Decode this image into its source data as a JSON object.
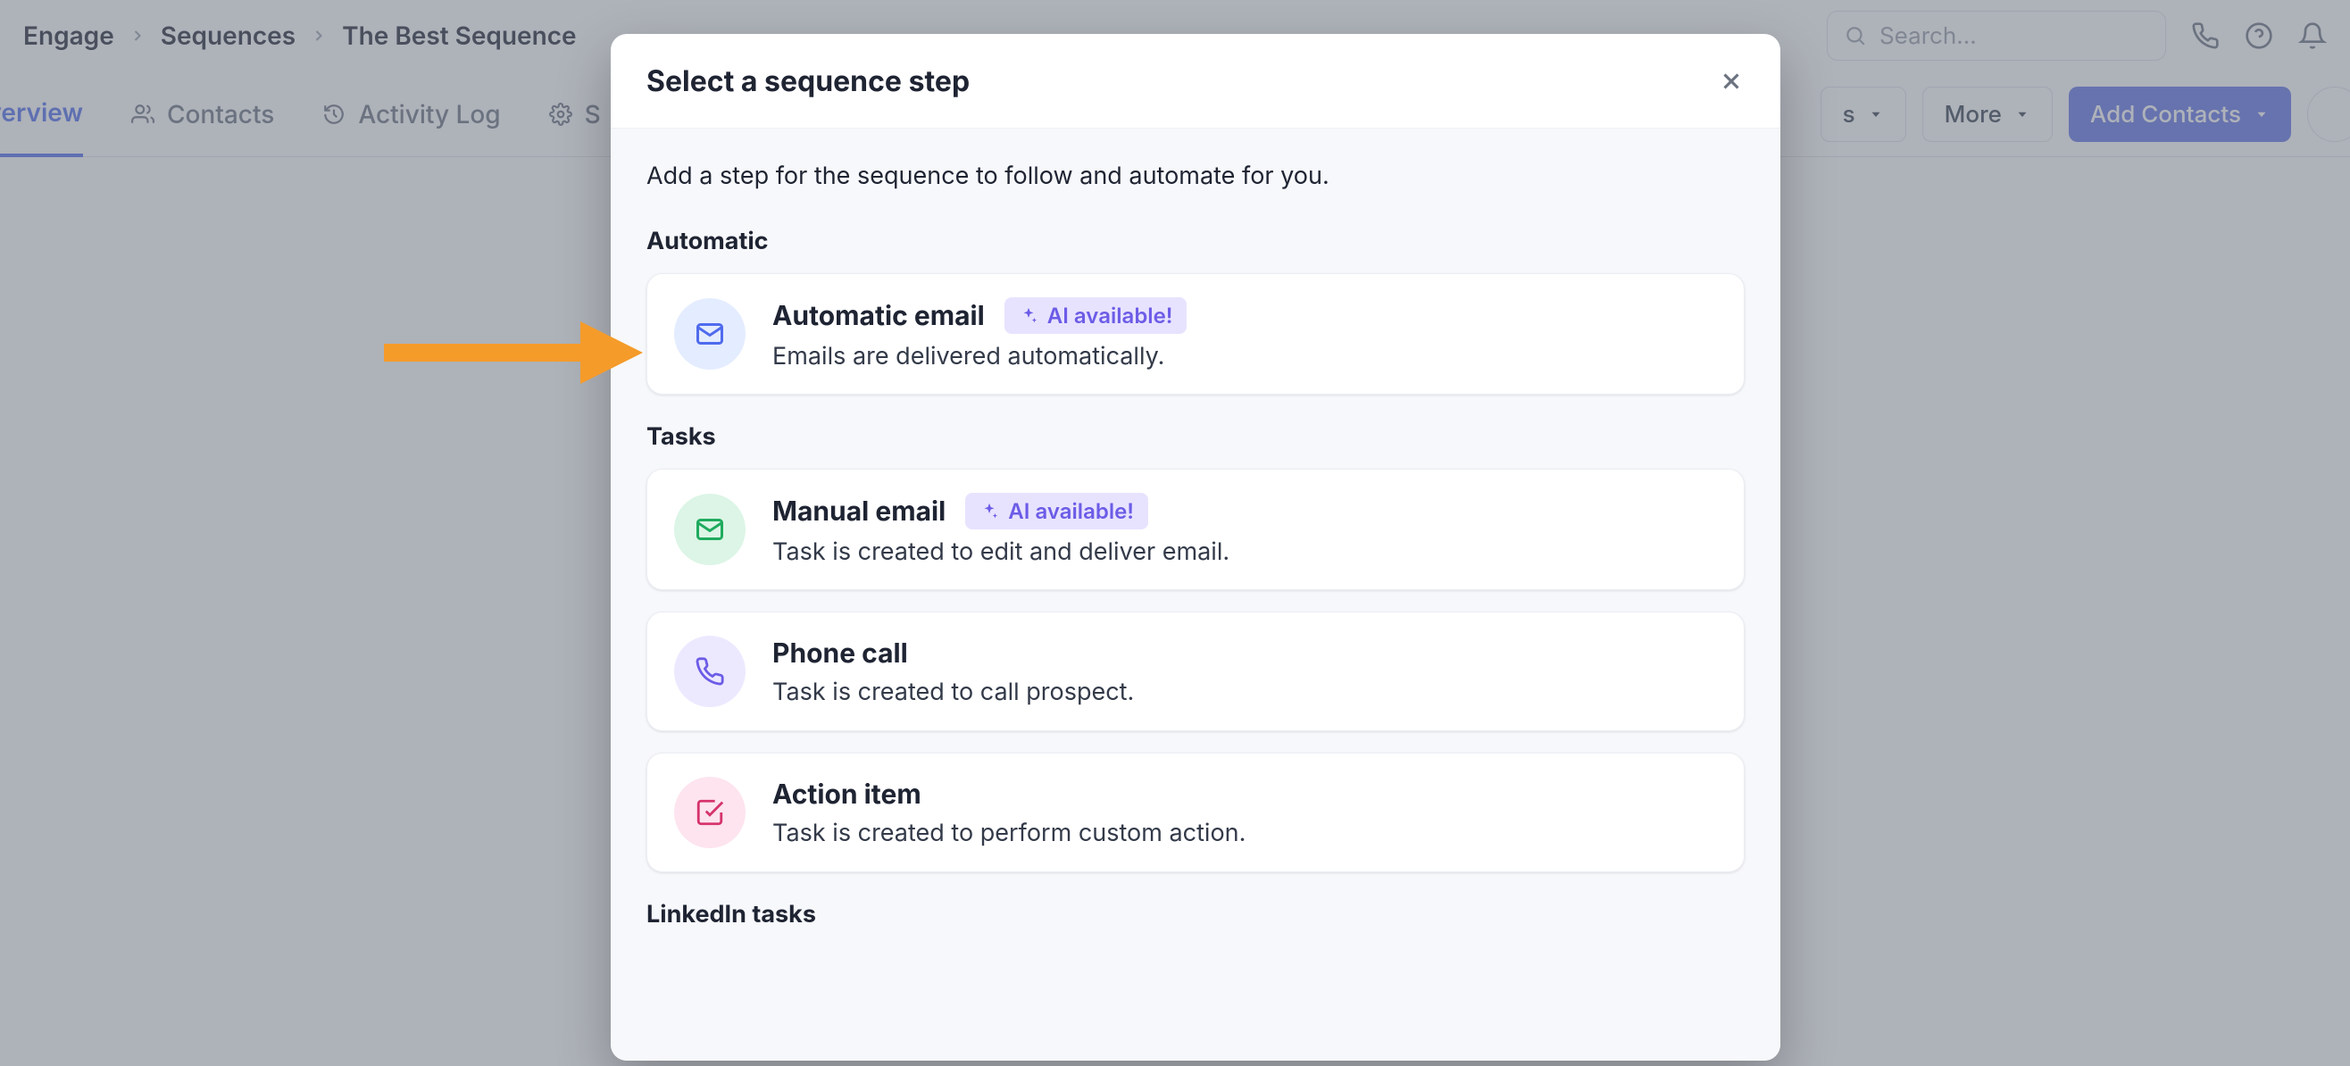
{
  "breadcrumb": [
    "Engage",
    "Sequences",
    "The Best Sequence"
  ],
  "search": {
    "placeholder": "Search..."
  },
  "tabs": {
    "overview": "Overview",
    "contacts": "Contacts",
    "activity_log": "Activity Log",
    "settings_prefix": "S"
  },
  "actions": {
    "trailing_dropdown_suffix": "s",
    "more": "More",
    "add_contacts": "Add Contacts"
  },
  "modal": {
    "title": "Select a sequence step",
    "description": "Add a step for the sequence to follow and automate for you.",
    "sections": {
      "automatic": {
        "label": "Automatic",
        "items": [
          {
            "title": "Automatic email",
            "desc": "Emails are delivered automatically.",
            "ai": "AI available!"
          }
        ]
      },
      "tasks": {
        "label": "Tasks",
        "items": [
          {
            "title": "Manual email",
            "desc": "Task is created to edit and deliver email.",
            "ai": "AI available!"
          },
          {
            "title": "Phone call",
            "desc": "Task is created to call prospect."
          },
          {
            "title": "Action item",
            "desc": "Task is created to perform custom action."
          }
        ]
      },
      "linkedin": {
        "label": "LinkedIn tasks"
      }
    }
  }
}
